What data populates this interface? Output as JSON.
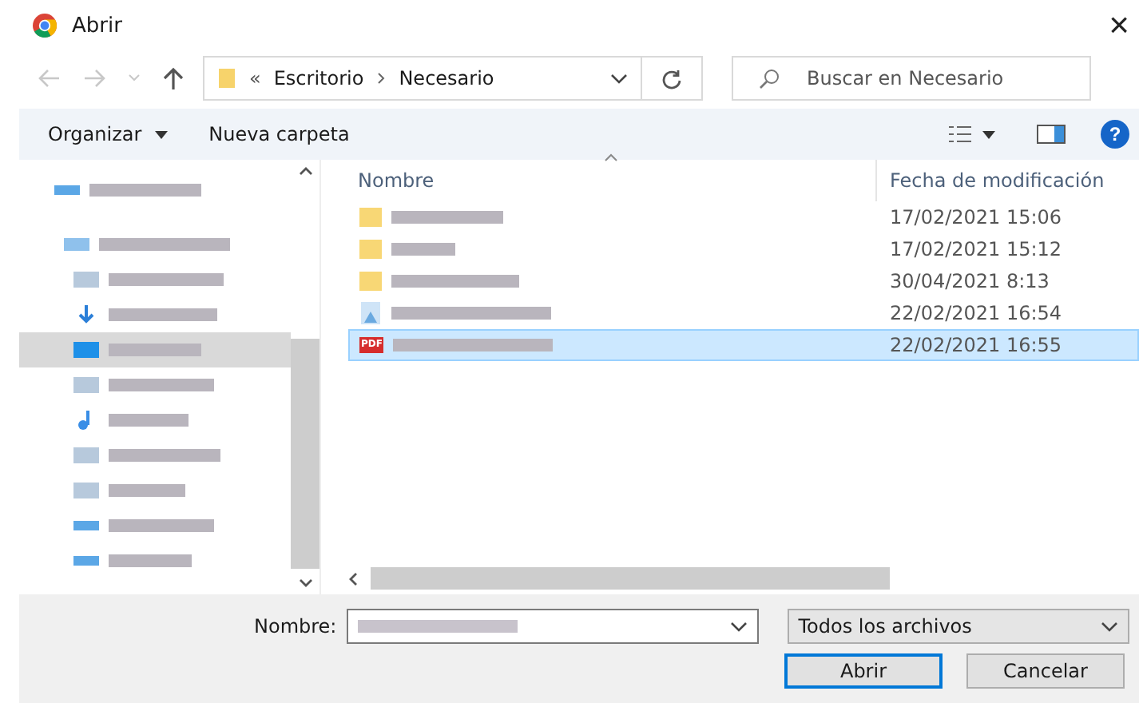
{
  "window": {
    "title": "Abrir",
    "close": "×"
  },
  "address": {
    "crumbs_marker": "«",
    "crumbs": [
      "Escritorio",
      "Necesario"
    ]
  },
  "search": {
    "placeholder": "Buscar en Necesario"
  },
  "toolbar": {
    "organize": "Organizar",
    "new_folder": "Nueva carpeta",
    "help": "?"
  },
  "sidebar": {
    "items": [
      {
        "kind": "drive",
        "selected": false
      },
      {
        "kind": "group",
        "selected": false
      },
      {
        "kind": "folder",
        "selected": false
      },
      {
        "kind": "download",
        "selected": false
      },
      {
        "kind": "desktop",
        "selected": true
      },
      {
        "kind": "folder",
        "selected": false
      },
      {
        "kind": "music",
        "selected": false
      },
      {
        "kind": "folder",
        "selected": false
      },
      {
        "kind": "folder",
        "selected": false
      },
      {
        "kind": "drive",
        "selected": false
      },
      {
        "kind": "drive",
        "selected": false
      }
    ]
  },
  "table": {
    "columns": [
      "Nombre",
      "Fecha de modificación"
    ],
    "rows": [
      {
        "kind": "folder",
        "date": "17/02/2021 15:06",
        "selected": false
      },
      {
        "kind": "folder",
        "date": "17/02/2021 15:12",
        "selected": false
      },
      {
        "kind": "folder",
        "date": "30/04/2021 8:13",
        "selected": false
      },
      {
        "kind": "image",
        "date": "22/02/2021 16:54",
        "selected": false
      },
      {
        "kind": "pdf",
        "date": "22/02/2021 16:55",
        "selected": true,
        "badge": "PDF"
      }
    ]
  },
  "footer": {
    "name_label": "Nombre:",
    "filter": "Todos los archivos",
    "buttons": [
      "Abrir",
      "Cancelar"
    ]
  }
}
